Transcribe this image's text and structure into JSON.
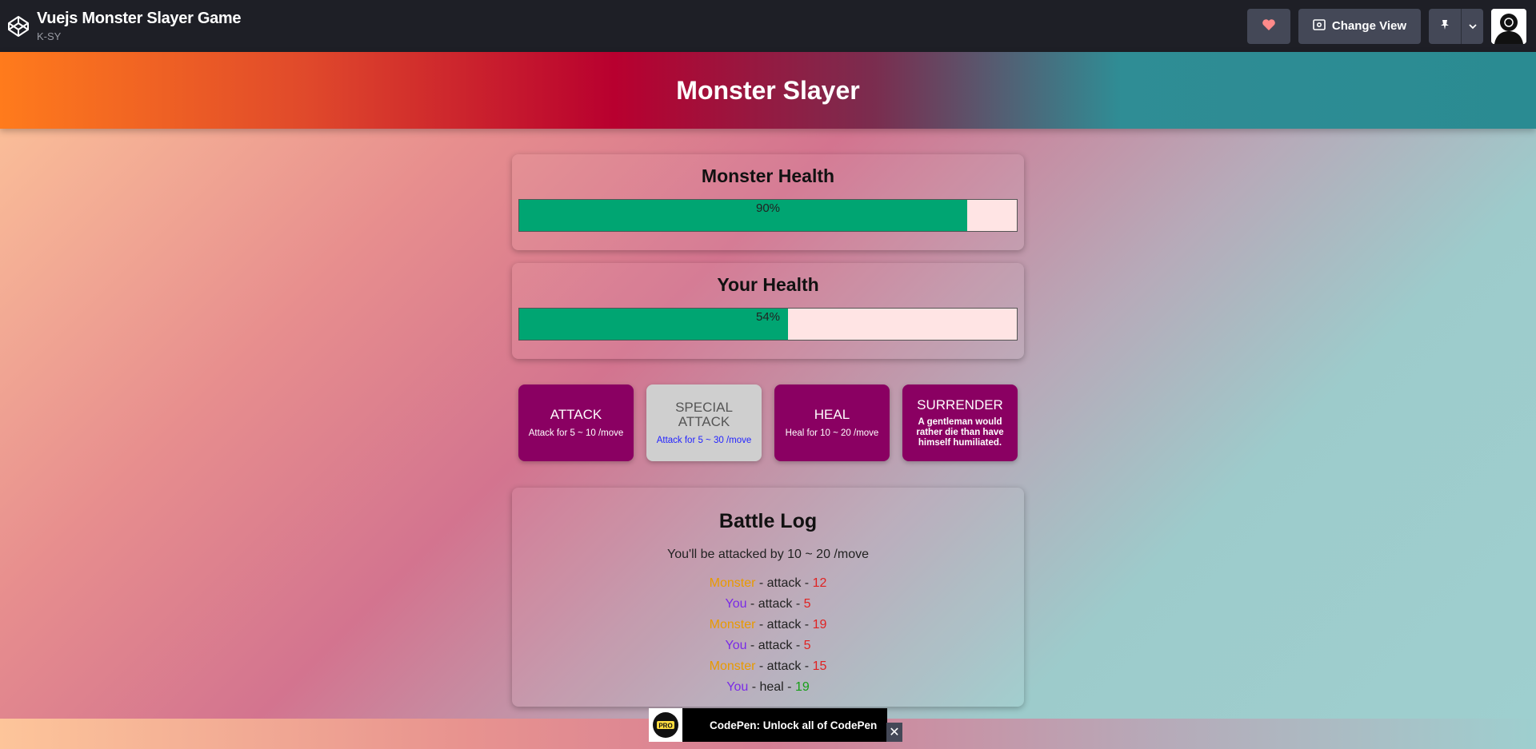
{
  "codepen": {
    "title": "Vuejs Monster Slayer Game",
    "author": "K-SY",
    "change_view_label": "Change View",
    "logo_icon": "codepen-logo-icon",
    "heart_icon": "heart-icon",
    "view_icon": "eye-icon",
    "pin_icon": "pin-icon",
    "caret_icon": "chevron-down-icon"
  },
  "app": {
    "title": "Monster Slayer",
    "monster_health": {
      "title": "Monster Health",
      "value": 90,
      "label": "90%"
    },
    "player_health": {
      "title": "Your Health",
      "value": 54,
      "label": "54%"
    },
    "controls": [
      {
        "label": "ATTACK",
        "desc": "Attack for 5 ~ 10 /move",
        "disabled": false
      },
      {
        "label": "SPECIAL ATTACK",
        "desc": "Attack for 5 ~ 30 /move",
        "disabled": true
      },
      {
        "label": "HEAL",
        "desc": "Heal for 10 ~ 20 /move",
        "disabled": false
      },
      {
        "label": "SURRENDER",
        "desc": "A gentleman would rather die than have himself humiliated.",
        "disabled": false
      }
    ],
    "battle_log": {
      "title": "Battle Log",
      "intro": "You'll be attacked by 10 ~ 20 /move",
      "entries": [
        {
          "who": "Monster",
          "action": "attack",
          "value": "12"
        },
        {
          "who": "You",
          "action": "attack",
          "value": "5"
        },
        {
          "who": "Monster",
          "action": "attack",
          "value": "19"
        },
        {
          "who": "You",
          "action": "attack",
          "value": "5"
        },
        {
          "who": "Monster",
          "action": "attack",
          "value": "15"
        },
        {
          "who": "You",
          "action": "heal",
          "value": "19"
        }
      ]
    }
  },
  "promo": {
    "badge": "PRO",
    "text": "CodePen: Unlock all of CodePen",
    "close": "✕"
  },
  "colors": {
    "health_fill": "#00a572",
    "health_empty": "#ffe4e4",
    "button": "#8a0062",
    "button_disabled": "#cfcfcf",
    "monster_name": "#e89a00",
    "you_name": "#7a2be6",
    "damage": "#e02222",
    "heal": "#159f15"
  }
}
